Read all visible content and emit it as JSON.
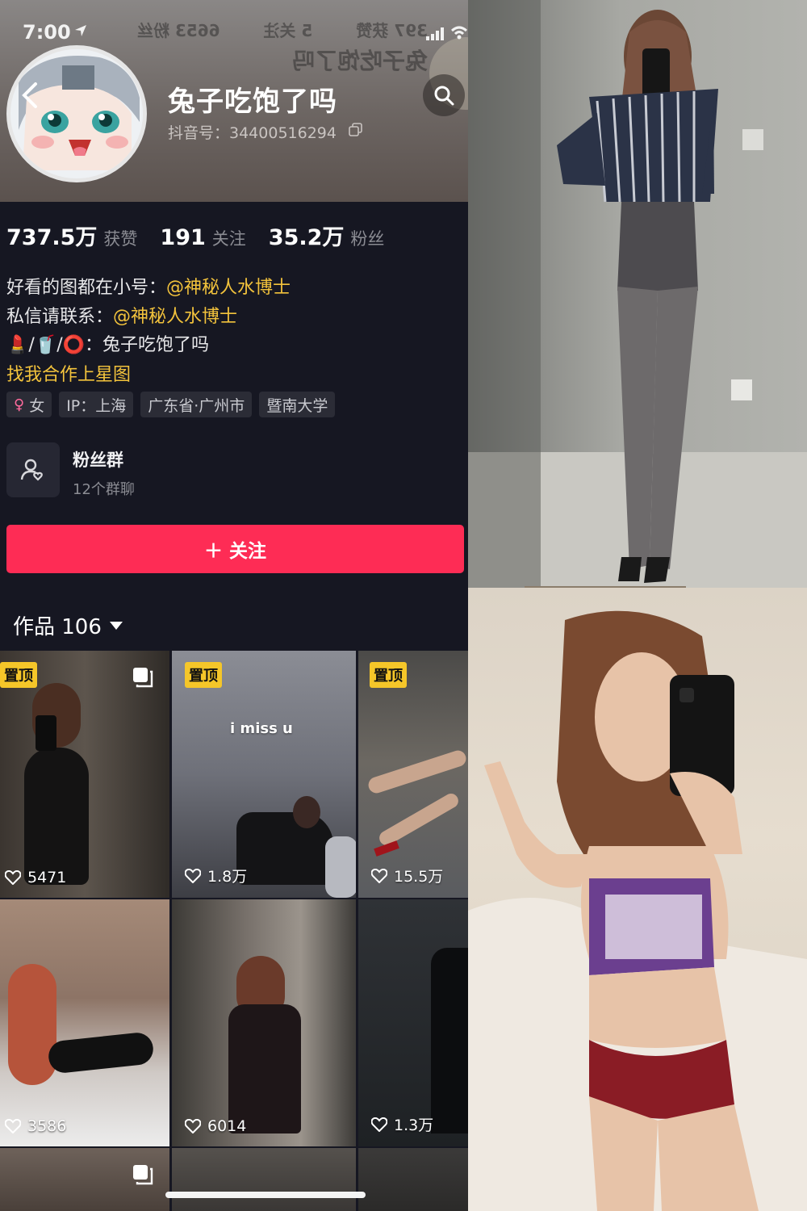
{
  "status_bar": {
    "time": "7:00"
  },
  "header": {
    "mirror_text_row1": [
      "397 获赞",
      "5 关注",
      "6653 粉丝"
    ],
    "mirror_text_row2": "兔子吃饱了吗",
    "name": "兔子吃饱了吗",
    "douyin_id": "抖音号：34400516294"
  },
  "stats": [
    {
      "value": "737.5万",
      "label": "获赞"
    },
    {
      "value": "191",
      "label": "关注"
    },
    {
      "value": "35.2万",
      "label": "粉丝"
    }
  ],
  "bio": {
    "line1_prefix": "好看的图都在小号：",
    "line1_mention": "@神秘人水博士",
    "line2_prefix": "私信请联系：",
    "line2_mention": "@神秘人水博士",
    "line3_emoji": "💄/🥤/⭕",
    "line3_text": "：兔子吃饱了吗",
    "line4": "找我合作上星图"
  },
  "tags": [
    {
      "icon": "♀",
      "label": "女"
    },
    {
      "label": "IP：上海"
    },
    {
      "label": "广东省·广州市"
    },
    {
      "label": "暨南大学"
    }
  ],
  "fan_group": {
    "title": "粉丝群",
    "subtitle": "12个群聊"
  },
  "follow_button": {
    "label": "＋ 关注"
  },
  "works_tab": {
    "label": "作品 106"
  },
  "grid": {
    "pin_label": "置顶",
    "caption": "i miss u",
    "items": [
      {
        "likes": "5471"
      },
      {
        "likes": "1.8万"
      },
      {
        "likes": "15.5万"
      },
      {
        "likes": "3586"
      },
      {
        "likes": "6014"
      },
      {
        "likes": "1.3万"
      }
    ]
  },
  "colors": {
    "accent": "#fe2c55",
    "mention": "#f3c33c",
    "pin": "#f5c629",
    "bg": "#161722"
  }
}
